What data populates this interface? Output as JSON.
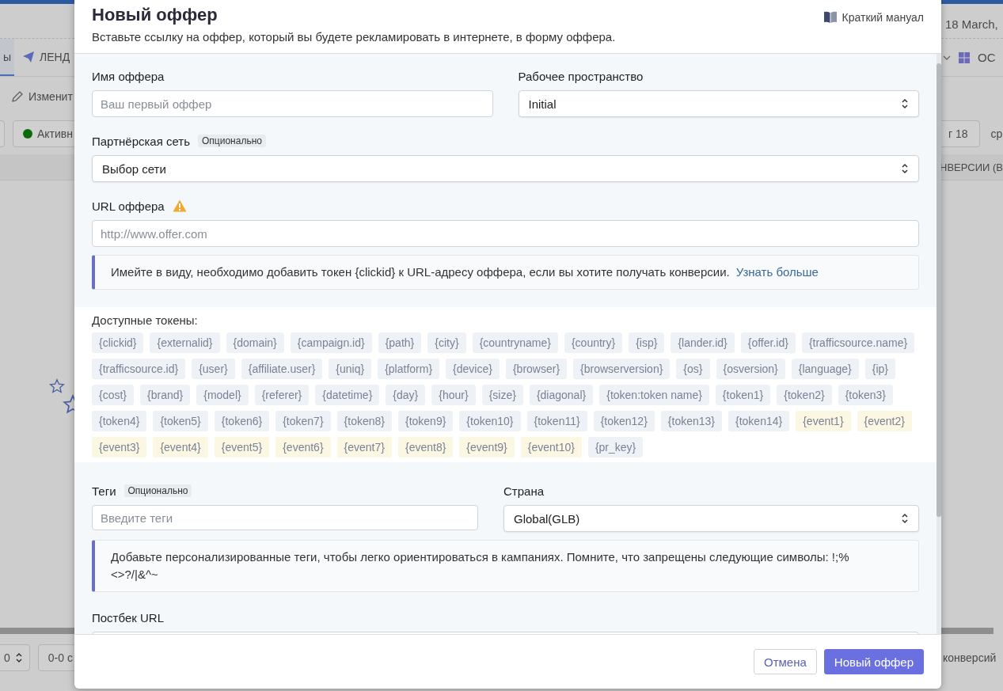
{
  "background": {
    "date": "18 March,",
    "tabs": [
      {
        "label": "ы",
        "selected": true,
        "kind": "text"
      },
      {
        "label": "ЛЕНД",
        "selected": false,
        "kind": "plane"
      }
    ],
    "os_label": "ОС",
    "edit_label": "Изменит",
    "status_filter": "Активн",
    "date_button": "г 18",
    "compare_label": "ср",
    "column_header": "НВЕРСИИ (В",
    "page_size": "0",
    "range_button": "0-0 с",
    "footer_text": "конверсий"
  },
  "modal": {
    "title": "Новый оффер",
    "subtitle": "Вставьте ссылку на оффер, который вы будете рекламировать в интернете, в форму оффера.",
    "manual_link": "Краткий мануал",
    "offer_name": {
      "label": "Имя оффера",
      "placeholder": "Ваш первый оффер"
    },
    "workspace": {
      "label": "Рабочее пространство",
      "value": "Initial"
    },
    "network": {
      "label": "Партнёрская сеть",
      "badge": "Опционально",
      "value": "Выбор сети"
    },
    "offer_url": {
      "label": "URL оффера",
      "warning": true,
      "placeholder": "http://www.offer.com"
    },
    "url_note": {
      "text": "Имейте в виду, необходимо добавить токен {clickid} к URL-адресу оффера, если вы хотите получать конверсии.",
      "link": "Узнать больше"
    },
    "tokens": {
      "label": "Доступные токены:",
      "items": [
        {
          "text": "{clickid}",
          "kind": "token"
        },
        {
          "text": "{externalid}",
          "kind": "token"
        },
        {
          "text": "{domain}",
          "kind": "token"
        },
        {
          "text": "{campaign.id}",
          "kind": "token"
        },
        {
          "text": "{path}",
          "kind": "token"
        },
        {
          "text": "{city}",
          "kind": "token"
        },
        {
          "text": "{countryname}",
          "kind": "token"
        },
        {
          "text": "{country}",
          "kind": "token"
        },
        {
          "text": "{isp}",
          "kind": "token"
        },
        {
          "text": "{lander.id}",
          "kind": "token"
        },
        {
          "text": "{offer.id}",
          "kind": "token"
        },
        {
          "text": "{trafficsource.name}",
          "kind": "token"
        },
        {
          "text": "{trafficsource.id}",
          "kind": "token"
        },
        {
          "text": "{user}",
          "kind": "token"
        },
        {
          "text": "{affiliate.user}",
          "kind": "token"
        },
        {
          "text": "{uniq}",
          "kind": "token"
        },
        {
          "text": "{platform}",
          "kind": "token"
        },
        {
          "text": "{device}",
          "kind": "token"
        },
        {
          "text": "{browser}",
          "kind": "token"
        },
        {
          "text": "{browserversion}",
          "kind": "token"
        },
        {
          "text": "{os}",
          "kind": "token"
        },
        {
          "text": "{osversion}",
          "kind": "token"
        },
        {
          "text": "{language}",
          "kind": "token"
        },
        {
          "text": "{ip}",
          "kind": "token"
        },
        {
          "text": "{cost}",
          "kind": "token"
        },
        {
          "text": "{brand}",
          "kind": "token"
        },
        {
          "text": "{model}",
          "kind": "token"
        },
        {
          "text": "{referer}",
          "kind": "token"
        },
        {
          "text": "{datetime}",
          "kind": "token"
        },
        {
          "text": "{day}",
          "kind": "token"
        },
        {
          "text": "{hour}",
          "kind": "token"
        },
        {
          "text": "{size}",
          "kind": "token"
        },
        {
          "text": "{diagonal}",
          "kind": "token"
        },
        {
          "text": "{token:token name}",
          "kind": "token"
        },
        {
          "text": "{token1}",
          "kind": "token"
        },
        {
          "text": "{token2}",
          "kind": "token"
        },
        {
          "text": "{token3}",
          "kind": "token"
        },
        {
          "text": "{token4}",
          "kind": "token"
        },
        {
          "text": "{token5}",
          "kind": "token"
        },
        {
          "text": "{token6}",
          "kind": "token"
        },
        {
          "text": "{token7}",
          "kind": "token"
        },
        {
          "text": "{token8}",
          "kind": "token"
        },
        {
          "text": "{token9}",
          "kind": "token"
        },
        {
          "text": "{token10}",
          "kind": "token"
        },
        {
          "text": "{token11}",
          "kind": "token"
        },
        {
          "text": "{token12}",
          "kind": "token"
        },
        {
          "text": "{token13}",
          "kind": "token"
        },
        {
          "text": "{token14}",
          "kind": "token"
        },
        {
          "text": "{event1}",
          "kind": "event"
        },
        {
          "text": "{event2}",
          "kind": "event"
        },
        {
          "text": "{event3}",
          "kind": "event"
        },
        {
          "text": "{event4}",
          "kind": "event"
        },
        {
          "text": "{event5}",
          "kind": "event"
        },
        {
          "text": "{event6}",
          "kind": "event"
        },
        {
          "text": "{event7}",
          "kind": "event"
        },
        {
          "text": "{event8}",
          "kind": "event"
        },
        {
          "text": "{event9}",
          "kind": "event"
        },
        {
          "text": "{event10}",
          "kind": "event"
        },
        {
          "text": "{pr_key}",
          "kind": "token"
        }
      ]
    },
    "tags": {
      "label": "Теги",
      "badge": "Опционально",
      "placeholder": "Введите теги"
    },
    "country": {
      "label": "Страна",
      "value": "Global(GLB)"
    },
    "tags_note": "Добавьте персонализированные теги, чтобы легко ориентироваться в кампаниях. Помните, что запрещены следующие символы: !;% <>?/|&^~",
    "postback": {
      "label": "Постбек URL"
    },
    "buttons": [
      {
        "label": "Отмена",
        "kind": "secondary"
      },
      {
        "label": "Новый оффер",
        "kind": "primary"
      }
    ]
  }
}
